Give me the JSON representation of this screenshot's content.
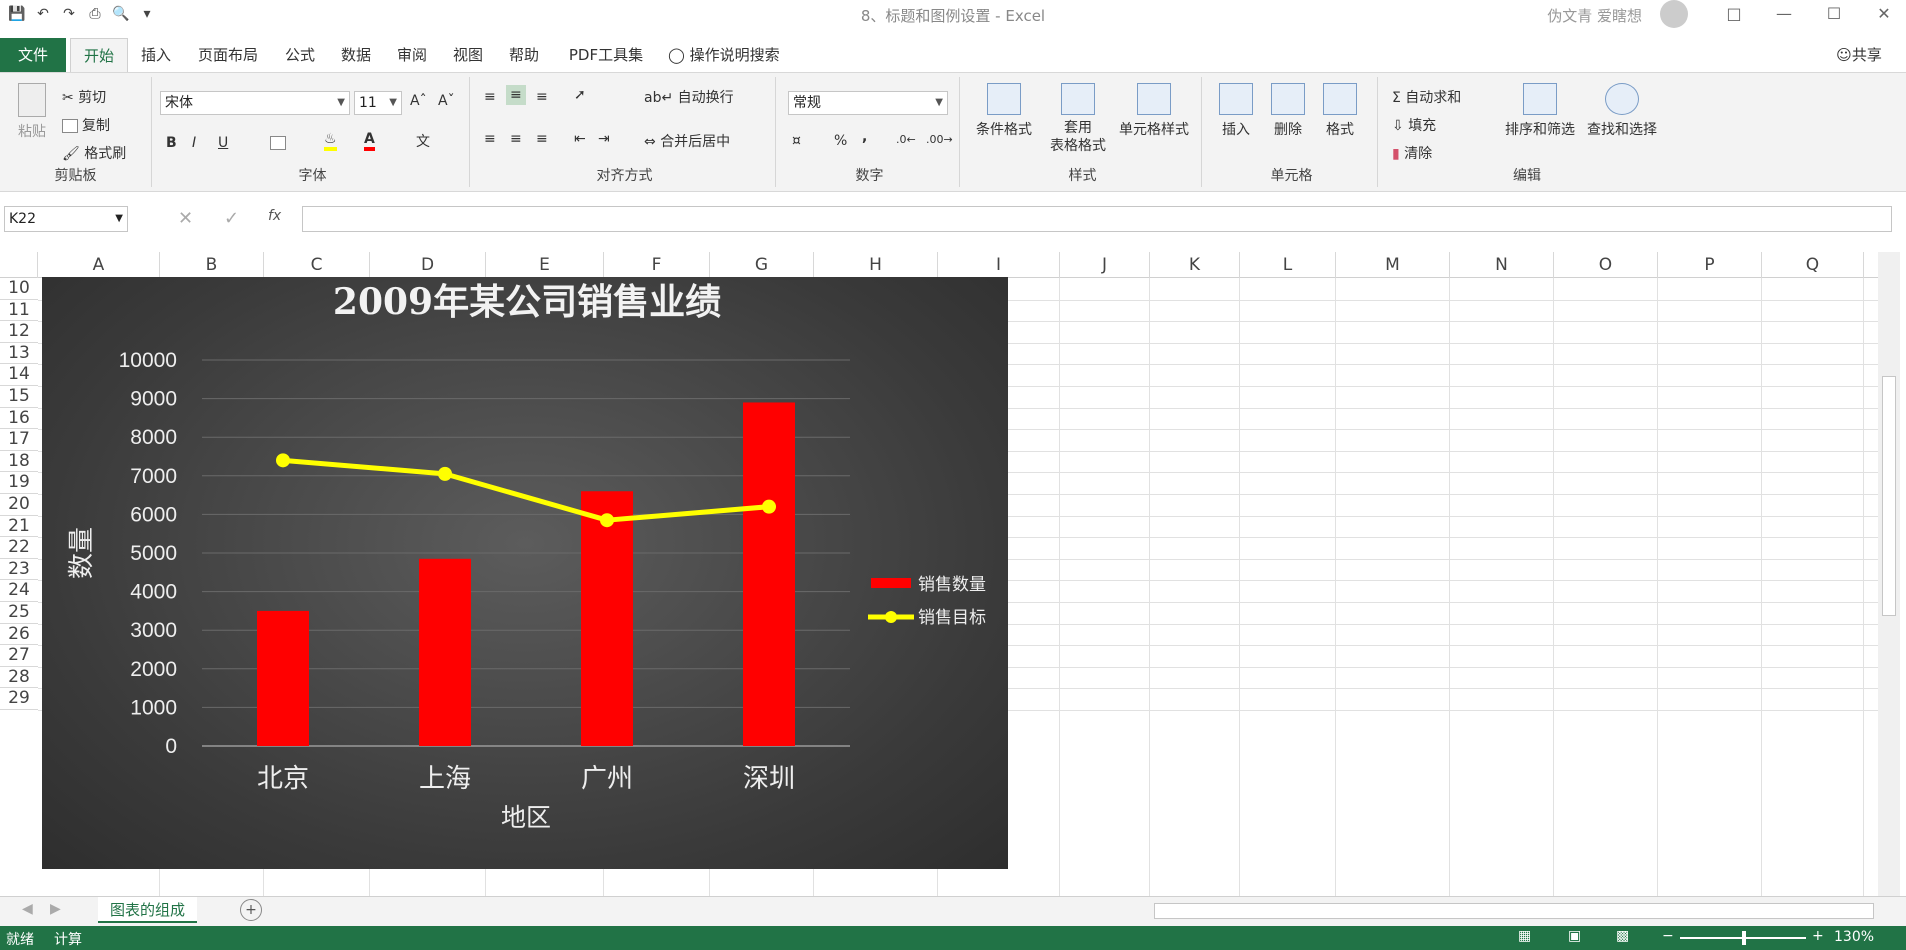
{
  "window": {
    "title": "8、标题和图例设置 - Excel",
    "user": "伪文青 爱瞎想"
  },
  "menu": {
    "tabs": [
      "文件",
      "开始",
      "插入",
      "页面布局",
      "公式",
      "数据",
      "审阅",
      "视图",
      "帮助",
      "PDF工具集"
    ],
    "search": "操作说明搜索",
    "share": "共享"
  },
  "ribbon": {
    "clipboard": {
      "paste": "粘贴",
      "cut": "剪切",
      "copy": "复制",
      "format_painter": "格式刷",
      "label": "剪贴板"
    },
    "font": {
      "name": "宋体",
      "size": "11",
      "bold": "B",
      "italic": "I",
      "underline": "U",
      "label": "字体"
    },
    "align": {
      "wrap": "自动换行",
      "merge": "合并后居中",
      "label": "对齐方式"
    },
    "number": {
      "format": "常规",
      "percent": "%",
      "comma": ",",
      "label": "数字"
    },
    "styles": {
      "conditional": "条件格式",
      "table_line1": "套用",
      "table_line2": "表格格式",
      "cell": "单元格样式",
      "label": "样式"
    },
    "cells": {
      "insert": "插入",
      "delete": "删除",
      "format": "格式",
      "label": "单元格"
    },
    "edit": {
      "autosum": "自动求和",
      "fill": "填充",
      "clear": "清除",
      "sort": "排序和筛选",
      "find": "查找和选择",
      "label": "编辑"
    }
  },
  "formula_bar": {
    "name_box": "K22",
    "fx": "fx",
    "value": ""
  },
  "columns": [
    "A",
    "B",
    "C",
    "D",
    "E",
    "F",
    "G",
    "H",
    "I",
    "J",
    "K",
    "L",
    "M",
    "N",
    "O",
    "P",
    "Q"
  ],
  "rows": [
    "10",
    "11",
    "12",
    "13",
    "14",
    "15",
    "16",
    "17",
    "18",
    "19",
    "20",
    "21",
    "22",
    "23",
    "24",
    "25",
    "26",
    "27",
    "28",
    "29"
  ],
  "chart_data": {
    "type": "bar",
    "title": "2009年某公司销售业绩",
    "xlabel": "地区",
    "ylabel": "数量",
    "categories": [
      "北京",
      "上海",
      "广州",
      "深圳"
    ],
    "ylim": [
      0,
      10000
    ],
    "yticks": [
      "0",
      "1000",
      "2000",
      "3000",
      "4000",
      "5000",
      "6000",
      "7000",
      "8000",
      "9000",
      "10000"
    ],
    "series": [
      {
        "name": "销售数量",
        "type": "bar",
        "values": [
          3500,
          4850,
          6600,
          8900
        ],
        "color": "#ff0000"
      },
      {
        "name": "销售目标",
        "type": "line",
        "values": [
          7400,
          7050,
          5850,
          6200
        ],
        "color": "#ffff00"
      }
    ],
    "legend_position": "right",
    "grid": true
  },
  "sheet": {
    "tab": "图表的组成"
  },
  "status": {
    "ready": "就绪",
    "calc": "计算",
    "zoom": "130%"
  }
}
